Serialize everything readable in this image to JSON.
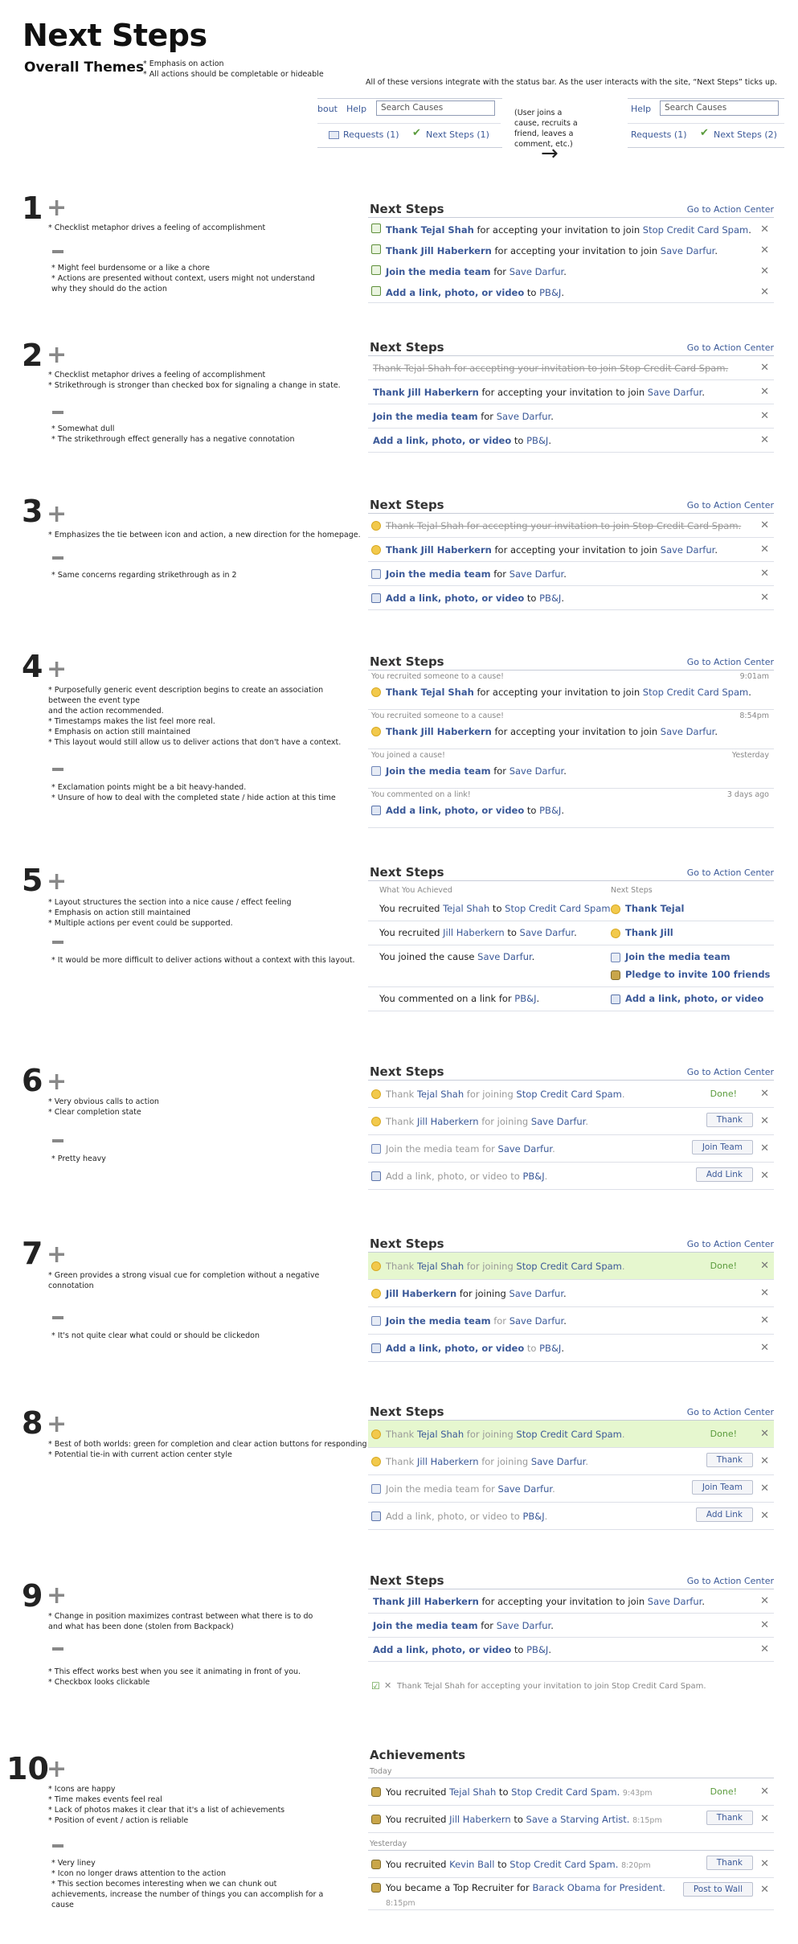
{
  "page": {
    "title": "Next Steps",
    "subtitle": "Overall Themes",
    "themes": [
      "* Emphasis on action",
      "* All actions should be completable or hideable"
    ],
    "intro": "All of these versions integrate with the status bar. As the user interacts with the site, “Next Steps” ticks up.",
    "bar1": {
      "about": "bout",
      "help": "Help",
      "search": "Search Causes",
      "requests": "Requests (1)",
      "next": "Next Steps (1)"
    },
    "bar2": {
      "help": "Help",
      "search": "Search Causes",
      "requests": "Requests (1)",
      "next": "Next Steps (2)"
    },
    "user_note": "(User joins a cause, recruits a friend, leaves a comment, etc.)",
    "arrow": "→"
  },
  "common": {
    "header": "Next Steps",
    "goto": "Go to Action Center",
    "plus": "+",
    "x": "✕"
  },
  "v1": {
    "num": "1",
    "pros": [
      "* Checklist metaphor drives a feeling of accomplishment"
    ],
    "cons": [
      "* Might feel burdensome or a like a chore",
      "* Actions are presented without context, users might not understand why they should do the action"
    ],
    "rows": [
      [
        "Thank Tejal Shah",
        " for accepting your invitation to join ",
        "Stop Credit Card Spam",
        "."
      ],
      [
        "Thank Jill Haberkern",
        " for accepting your invitation to join ",
        "Save Darfur",
        "."
      ],
      [
        "Join the media team",
        " for ",
        "Save Darfur",
        "."
      ],
      [
        "Add a link, photo, or video",
        " to ",
        "PB&J",
        "."
      ]
    ]
  },
  "v2": {
    "num": "2",
    "pros": [
      "* Checklist metaphor drives a feeling of accomplishment",
      "* Strikethrough is stronger than checked box for signaling a change in state."
    ],
    "cons": [
      "* Somewhat dull",
      "* The strikethrough effect generally has a negative connotation"
    ],
    "struck": "Thank Tejal Shah for accepting your invitation to join Stop Credit Card Spam."
  },
  "v3": {
    "num": "3",
    "pros": [
      "* Emphasizes the tie between icon and action, a new direction for the homepage."
    ],
    "cons": [
      "* Same concerns regarding strikethrough as in 2"
    ],
    "struck": "Thank Tejal Shah for accepting your invitation to join Stop Credit Card Spam."
  },
  "v4": {
    "num": "4",
    "pros": [
      "* Purposefully generic event description begins to create an association between the event type",
      "and the action recommended.",
      "* Timestamps makes the list feel more real.",
      "* Emphasis on action still maintained",
      "* This layout would still allow us to deliver actions that don't have a context."
    ],
    "cons": [
      "* Exclamation points might be a bit heavy-handed.",
      "* Unsure of how to deal with the completed state / hide action at this time"
    ],
    "events": [
      {
        "desc": "You recruited someone to a cause!",
        "time": "9:01am"
      },
      {
        "desc": "You recruited someone to a cause!",
        "time": "8:54pm"
      },
      {
        "desc": "You joined a cause!",
        "time": "Yesterday"
      },
      {
        "desc": "You commented on a link!",
        "time": "3 days ago"
      }
    ]
  },
  "v5": {
    "num": "5",
    "pros": [
      "* Layout structures the section into a nice cause / effect feeling",
      "* Emphasis on action still maintained",
      "* Multiple actions per event could be supported."
    ],
    "cons": [
      "* It would be more difficult to deliver actions without a context with this layout."
    ],
    "col1": "What You Achieved",
    "col2": "Next Steps",
    "a1": [
      "You recruited ",
      "Tejal Shah",
      " to ",
      "Stop Credit Card Spam",
      "."
    ],
    "a2": [
      "You recruited ",
      "Jill Haberkern",
      " to ",
      "Save Darfur",
      "."
    ],
    "a3": [
      "You joined the cause ",
      "Save Darfur",
      "."
    ],
    "a4": [
      "You commented on a link for ",
      "PB&J",
      "."
    ],
    "n1": "Thank Tejal",
    "n2": "Thank Jill",
    "n3": "Join the media team",
    "n3b": "Pledge to invite 100 friends",
    "n4": "Add a link, photo, or video"
  },
  "v6": {
    "num": "6",
    "pros": [
      "* Very obvious calls to action",
      "* Clear completion state"
    ],
    "cons": [
      "* Pretty heavy"
    ],
    "done": "Done!",
    "thank": "Thank",
    "join": "Join Team",
    "add": "Add Link"
  },
  "v7": {
    "num": "7",
    "pros": [
      "* Green provides a strong visual cue for completion without a negative connotation"
    ],
    "cons": [
      "* It's not quite clear what could or should be clickedon"
    ]
  },
  "v8": {
    "num": "8",
    "pros": [
      "* Best of both worlds: green for completion and clear action buttons for responding",
      "* Potential  tie-in with current action center style"
    ],
    "cons": []
  },
  "v9": {
    "num": "9",
    "pros": [
      "* Change in position maximizes contrast between what there is to do and what has been done (stolen from Backpack)"
    ],
    "cons": [
      "* This effect works best when you see it animating in front of you.",
      "* Checkbox looks clickable"
    ],
    "done_row": "Thank Tejal Shah for accepting your invitation to join Stop Credit Card Spam."
  },
  "v10": {
    "num": "10",
    "title": "Achievements",
    "today": "Today",
    "yesterday": "Yesterday",
    "pros": [
      "* Icons are happy",
      "* Time makes events feel real",
      "* Lack of photos makes it clear that it's a list of achievements",
      "* Position of event / action is reliable"
    ],
    "cons": [
      "* Very liney",
      "* Icon no longer draws attention to the action",
      "* This section becomes interesting when we can chunk out achievements, increase the number of things you can accomplish for a cause"
    ],
    "r1": [
      "You recruited ",
      "Tejal Shah",
      " to ",
      "Stop Credit Card Spam.",
      "9:43pm"
    ],
    "r2": [
      "You recruited ",
      "Jill Haberkern",
      " to ",
      "Save a Starving Artist.",
      "8:15pm"
    ],
    "r3": [
      "You recruited ",
      "Kevin Ball",
      " to ",
      "Stop Credit Card Spam.",
      "8:20pm"
    ],
    "r4": [
      "You became a Top Recruiter for ",
      "Barack Obama for President.",
      "8:15pm"
    ],
    "post": "Post to Wall"
  }
}
